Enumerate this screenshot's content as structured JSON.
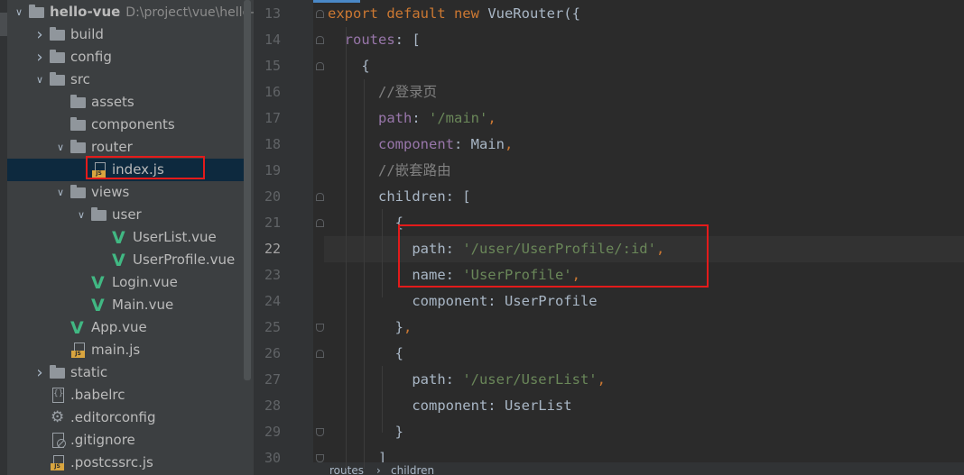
{
  "project_tree": {
    "items": [
      {
        "label": "hello-vue",
        "hint": "D:\\project\\vue\\hello-vue",
        "icon": "folder-icon",
        "arrow": "expanded"
      },
      {
        "label": "build",
        "icon": "folder-icon",
        "arrow": "collapsed"
      },
      {
        "label": "config",
        "icon": "folder-icon",
        "arrow": "collapsed"
      },
      {
        "label": "src",
        "icon": "folder-icon",
        "arrow": "expanded"
      },
      {
        "label": "assets",
        "icon": "folder-icon",
        "arrow": "none"
      },
      {
        "label": "components",
        "icon": "folder-icon",
        "arrow": "none"
      },
      {
        "label": "router",
        "icon": "folder-icon",
        "arrow": "expanded"
      },
      {
        "label": "index.js",
        "icon": "js-file-icon",
        "arrow": "none",
        "selected": true
      },
      {
        "label": "views",
        "icon": "folder-icon",
        "arrow": "expanded"
      },
      {
        "label": "user",
        "icon": "folder-icon",
        "arrow": "expanded"
      },
      {
        "label": "UserList.vue",
        "icon": "vue-file-icon",
        "arrow": "none"
      },
      {
        "label": "UserProfile.vue",
        "icon": "vue-file-icon",
        "arrow": "none"
      },
      {
        "label": "Login.vue",
        "icon": "vue-file-icon",
        "arrow": "none"
      },
      {
        "label": "Main.vue",
        "icon": "vue-file-icon",
        "arrow": "none"
      },
      {
        "label": "App.vue",
        "icon": "vue-file-icon",
        "arrow": "none"
      },
      {
        "label": "main.js",
        "icon": "js-file-icon",
        "arrow": "none"
      },
      {
        "label": "static",
        "icon": "folder-icon",
        "arrow": "collapsed"
      },
      {
        "label": ".babelrc",
        "icon": "babelrc-file-icon",
        "arrow": "none"
      },
      {
        "label": ".editorconfig",
        "icon": "gear-icon",
        "arrow": "none"
      },
      {
        "label": ".gitignore",
        "icon": "gitignore-file-icon",
        "arrow": "none"
      },
      {
        "label": ".postcssrc.js",
        "icon": "js-file-icon",
        "arrow": "none"
      }
    ]
  },
  "editor": {
    "current_line": 22,
    "lines": [
      {
        "n": "13",
        "tokens": [
          [
            "kw",
            "export default new "
          ],
          [
            "pl",
            "VueRouter({"
          ]
        ]
      },
      {
        "n": "14",
        "tokens": [
          [
            "pr",
            "  routes"
          ],
          [
            "pl",
            ": ["
          ]
        ]
      },
      {
        "n": "15",
        "tokens": [
          [
            "pl",
            "    {"
          ]
        ]
      },
      {
        "n": "16",
        "tokens": [
          [
            "cm",
            "      //登录页"
          ]
        ]
      },
      {
        "n": "17",
        "tokens": [
          [
            "pr",
            "      path"
          ],
          [
            "pl",
            ": "
          ],
          [
            "st",
            "'/main'"
          ],
          [
            "kw",
            ","
          ]
        ]
      },
      {
        "n": "18",
        "tokens": [
          [
            "pr",
            "      component"
          ],
          [
            "pl",
            ": Main"
          ],
          [
            "kw",
            ","
          ]
        ]
      },
      {
        "n": "19",
        "tokens": [
          [
            "cm",
            "      //嵌套路由"
          ]
        ]
      },
      {
        "n": "20",
        "tokens": [
          [
            "pl",
            "      children: ["
          ]
        ]
      },
      {
        "n": "21",
        "tokens": [
          [
            "pl",
            "        {"
          ]
        ]
      },
      {
        "n": "22",
        "tokens": [
          [
            "pl",
            "          path: "
          ],
          [
            "st",
            "'/user/UserProfile/:id'"
          ],
          [
            "kw",
            ","
          ]
        ]
      },
      {
        "n": "23",
        "tokens": [
          [
            "pl",
            "          name: "
          ],
          [
            "st",
            "'UserProfile'"
          ],
          [
            "kw",
            ","
          ]
        ]
      },
      {
        "n": "24",
        "tokens": [
          [
            "pl",
            "          component: UserProfile"
          ]
        ]
      },
      {
        "n": "25",
        "tokens": [
          [
            "pl",
            "        }"
          ],
          [
            "kw",
            ","
          ]
        ]
      },
      {
        "n": "26",
        "tokens": [
          [
            "pl",
            "        {"
          ]
        ]
      },
      {
        "n": "27",
        "tokens": [
          [
            "pl",
            "          path: "
          ],
          [
            "st",
            "'/user/UserList'"
          ],
          [
            "kw",
            ","
          ]
        ]
      },
      {
        "n": "28",
        "tokens": [
          [
            "pl",
            "          component: UserList"
          ]
        ]
      },
      {
        "n": "29",
        "tokens": [
          [
            "pl",
            "        }"
          ]
        ]
      },
      {
        "n": "30",
        "tokens": [
          [
            "pl",
            "      ]"
          ]
        ]
      }
    ],
    "breadcrumb": [
      "routes",
      "children"
    ]
  },
  "colors": {
    "tree_bg": "#3c3f41",
    "editor_bg": "#2b2b2b",
    "keyword": "#cc7832",
    "property": "#9876aa",
    "string": "#6a8759",
    "comment": "#808080",
    "highlight_box": "#e31b1b"
  }
}
